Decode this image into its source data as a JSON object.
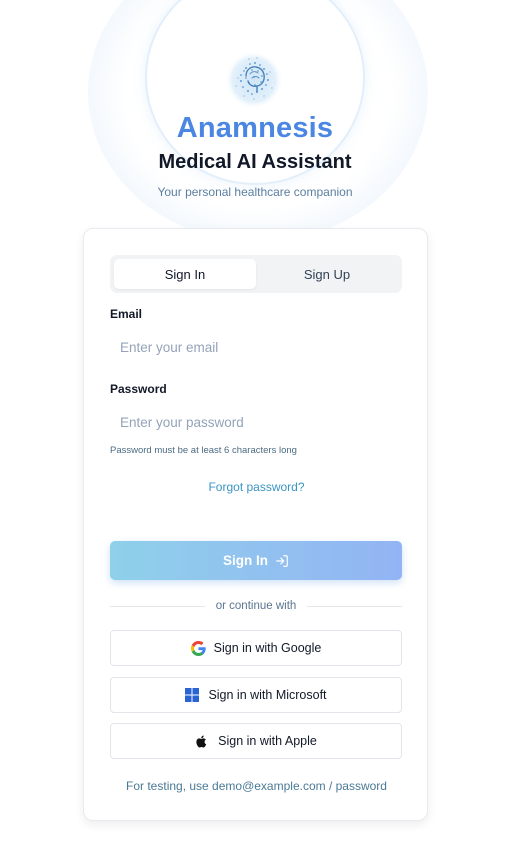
{
  "app": {
    "title": "Anamnesis",
    "subtitle": "Medical AI Assistant",
    "tagline": "Your personal healthcare companion"
  },
  "tabs": [
    {
      "label": "Sign In",
      "active": true
    },
    {
      "label": "Sign Up",
      "active": false
    }
  ],
  "form": {
    "email_label": "Email",
    "email_placeholder": "Enter your email",
    "email_value": "",
    "password_label": "Password",
    "password_placeholder": "Enter your password",
    "password_value": "",
    "password_hint": "Password must be at least 6 characters long",
    "forgot_label": "Forgot password?",
    "submit_label": "Sign In",
    "submit_icon": "log-in-icon"
  },
  "divider_text": "or continue with",
  "social": [
    {
      "label": "Sign in with Google",
      "icon": "google-icon"
    },
    {
      "label": "Sign in with Microsoft",
      "icon": "microsoft-icon"
    },
    {
      "label": "Sign in with Apple",
      "icon": "apple-icon"
    }
  ],
  "footer_note": "For testing, use demo@example.com / password",
  "colors": {
    "brand": "#4a86e2",
    "button_gradient_start": "#8fd0ea",
    "button_gradient_end": "#93b4f4",
    "link": "#3b95c4"
  }
}
